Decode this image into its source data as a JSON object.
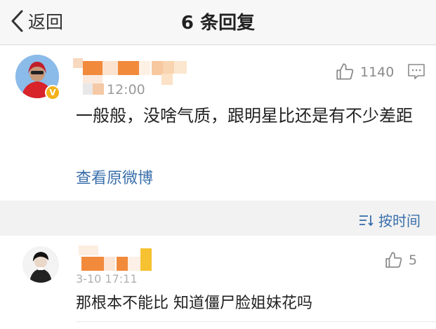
{
  "header": {
    "back_label": "返回",
    "title": "6 条回复"
  },
  "main_comment": {
    "time": "12:00",
    "like_count": "1140",
    "text": "一般般，没啥气质，跟明星比还是有不少差距",
    "view_original": "查看原微博",
    "verified_badge": "V"
  },
  "sort": {
    "label": "按时间"
  },
  "reply": {
    "time": "3-10 17:11",
    "like_count": "5",
    "text": "那根本不能比 知道僵尸脸姐妹花吗"
  },
  "colors": {
    "link": "#3a6fab",
    "badge": "#f3b21a",
    "blur_orange": "#f28a3c",
    "blur_peach": "#f7c79e",
    "blur_yellow": "#f6c231"
  },
  "icons": [
    "chevron-left-icon",
    "thumbs-up-icon",
    "comment-icon",
    "sort-icon",
    "verified-icon"
  ]
}
